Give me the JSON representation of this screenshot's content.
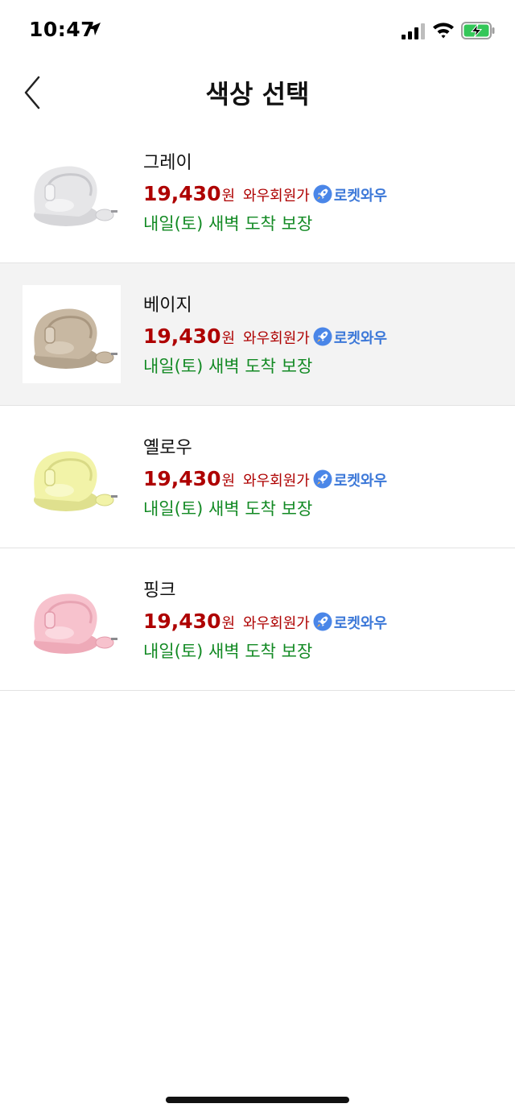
{
  "status_bar": {
    "time": "10:47",
    "icons": [
      "location-arrow-icon",
      "cellular-signal-icon",
      "wifi-icon",
      "battery-charging-icon"
    ],
    "battery_color": "#34c759"
  },
  "header": {
    "title": "색상 선택",
    "back_icon": "chevron-left-icon"
  },
  "colors": {
    "price": "#ae0000",
    "delivery": "#138a24",
    "rocket": "#3c78d8",
    "selected_row_bg": "#f3f3f3"
  },
  "options": [
    {
      "name": "그레이",
      "price": "19,430",
      "price_unit": "원",
      "member_label": "와우회원가",
      "badge_icon": "rocket-icon",
      "badge_label": "로켓와우",
      "delivery": "내일(토) 새벽 도착 보장",
      "selected": false,
      "swatch": "#e6e6e8"
    },
    {
      "name": "베이지",
      "price": "19,430",
      "price_unit": "원",
      "member_label": "와우회원가",
      "badge_icon": "rocket-icon",
      "badge_label": "로켓와우",
      "delivery": "내일(토) 새벽 도착 보장",
      "selected": true,
      "swatch": "#c8b8a2"
    },
    {
      "name": "옐로우",
      "price": "19,430",
      "price_unit": "원",
      "member_label": "와우회원가",
      "badge_icon": "rocket-icon",
      "badge_label": "로켓와우",
      "delivery": "내일(토) 새벽 도착 보장",
      "selected": false,
      "swatch": "#f2f3a8"
    },
    {
      "name": "핑크",
      "price": "19,430",
      "price_unit": "원",
      "member_label": "와우회원가",
      "badge_icon": "rocket-icon",
      "badge_label": "로켓와우",
      "delivery": "내일(토) 새벽 도착 보장",
      "selected": false,
      "swatch": "#f7c2cd"
    }
  ]
}
